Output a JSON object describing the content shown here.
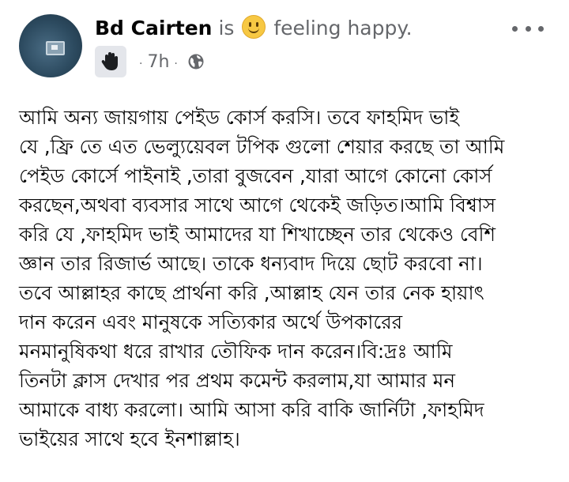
{
  "post": {
    "author": "Bd Cairten",
    "feeling_prefix": "is",
    "feeling_text": "feeling happy.",
    "timestamp": "7h",
    "separator": "·",
    "icons": {
      "avatar": "profile-photo",
      "feeling": "smiley-face-icon",
      "badge": "waving-hand-icon",
      "audience": "globe-icon",
      "menu": "more-options-icon"
    },
    "colors": {
      "text": "#050505",
      "secondary": "#65676b",
      "badge_bg": "#e4e6eb",
      "smiley": "#f7c843"
    },
    "body_lines": [
      "আমি অন্য জায়গায় পেইড কোর্স করসি। তবে ফাহমিদ ভাই",
      "যে ,ফ্রি তে এত ভেল্যুয়েবল টপিক গুলো শেয়ার করছে তা আমি",
      "পেইড কোর্সে পাইনাই ,তারা বুজবেন ,যারা আগে কোনো  কোর্স",
      "করছেন,অথবা ব্যবসার সাথে আগে থেকেই জড়িত।আমি বিশ্বাস",
      "করি যে ,ফাহমিদ ভাই আমাদের যা শিখাচ্ছেন তার থেকেও বেশি",
      "জ্ঞান তার রিজার্ভ আছে। তাকে ধন্যবাদ দিয়ে ছোট করবো না।",
      "তবে আল্লাহর কাছে প্রার্থনা করি ,আল্লাহ যেন তার নেক হায়াৎ",
      "দান  করেন এবং মানুষকে সত্যিকার অর্থে উপকারের",
      "মনমানুষিকথা ধরে রাখার তৌফিক দান করেন।বি:দ্রঃ আমি",
      "তিনটা ক্লাস দেখার পর প্রথম কমেন্ট করলাম,যা আমার মন",
      "আমাকে বাধ্য করলো। আমি আসা করি বাকি জার্নিটা ,ফাহমিদ",
      "ভাইয়ের সাথে হবে ইনশাল্লাহ।"
    ]
  }
}
